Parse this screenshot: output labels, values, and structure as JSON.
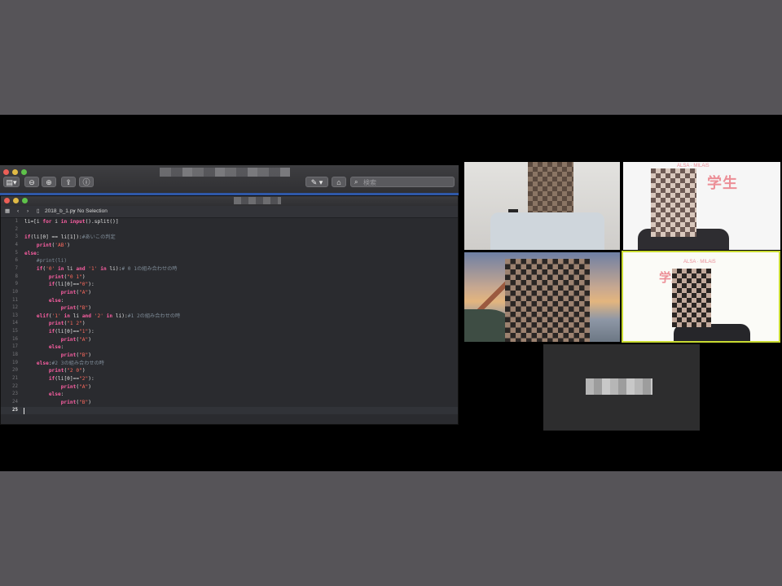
{
  "editor": {
    "search_placeholder": "検索",
    "tab": {
      "file": "2018_b_1.py",
      "selection": "No Selection"
    },
    "lines": [
      {
        "n": "1",
        "text": "li=[i for i in input().split()]"
      },
      {
        "n": "2",
        "text": ""
      },
      {
        "n": "3",
        "text": "if(li[0] == li[1]):#あいこの判定"
      },
      {
        "n": "4",
        "text": "    print('AB')"
      },
      {
        "n": "5",
        "text": "else:"
      },
      {
        "n": "6",
        "text": "    #print(li)"
      },
      {
        "n": "7",
        "text": "    if('0' in li and '1' in li):# 0 1の組み合わせの時"
      },
      {
        "n": "8",
        "text": "        print(\"0 1\")"
      },
      {
        "n": "9",
        "text": "        if(li[0]==\"0\"):"
      },
      {
        "n": "10",
        "text": "            print(\"A\")"
      },
      {
        "n": "11",
        "text": "        else:"
      },
      {
        "n": "12",
        "text": "            print(\"B\")"
      },
      {
        "n": "13",
        "text": "    elif('1' in li and '2' in li):#1 2の組み合わせの時"
      },
      {
        "n": "14",
        "text": "        print(\"1 2\")"
      },
      {
        "n": "15",
        "text": "        if(li[0]==\"1\"):"
      },
      {
        "n": "16",
        "text": "            print(\"A\")"
      },
      {
        "n": "17",
        "text": "        else:"
      },
      {
        "n": "18",
        "text": "            print(\"B\")"
      },
      {
        "n": "19",
        "text": "    else:#2 3の組み合わせの時"
      },
      {
        "n": "20",
        "text": "        print(\"2 0\")"
      },
      {
        "n": "21",
        "text": "        if(li[0]==\"2\"):"
      },
      {
        "n": "22",
        "text": "            print(\"A\")"
      },
      {
        "n": "23",
        "text": "        else:"
      },
      {
        "n": "24",
        "text": "            print(\"B\")"
      },
      {
        "n": "25",
        "text": ""
      }
    ]
  },
  "video": {
    "tile_b_sign": "学生",
    "tile_b_small": "ALSA · MILAiS",
    "tile_d_sign": "学生",
    "tile_d_small": "ALSA · MILAiS"
  },
  "colors": {
    "keyword": "#fc5fa3",
    "string": "#fc6a5d",
    "comment": "#7f8c98",
    "speaker_highlight": "#c9db32"
  }
}
